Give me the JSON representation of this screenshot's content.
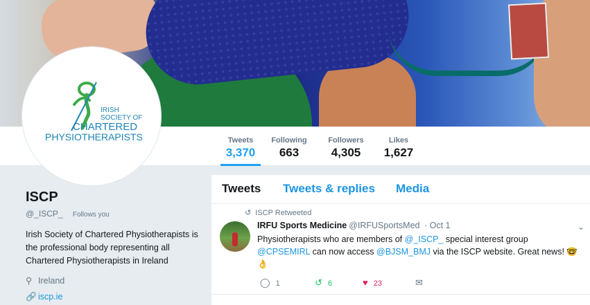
{
  "profile": {
    "name": "ISCP",
    "handle": "@_ISCP_",
    "follows_you": "Follows you",
    "bio": "Irish Society of Chartered Physiotherapists is the professional body representing all Chartered Physiotherapists in Ireland",
    "location": "Ireland",
    "website": "iscp.ie",
    "logo_lines": [
      "IRISH",
      "SOCIETY OF",
      "CHARTERED",
      "PHYSIOTHERAPISTS"
    ]
  },
  "stats": [
    {
      "label": "Tweets",
      "value": "3,370"
    },
    {
      "label": "Following",
      "value": "663"
    },
    {
      "label": "Followers",
      "value": "4,305"
    },
    {
      "label": "Likes",
      "value": "1,627"
    }
  ],
  "tabs": [
    "Tweets",
    "Tweets & replies",
    "Media"
  ],
  "tweet": {
    "retweeted_by": "ISCP Retweeted",
    "author_name": "IRFU Sports Medicine",
    "author_handle": "@IRFUSportsMed",
    "time": "· Oct 1",
    "text_1": "Physiotherapists who are members of ",
    "mention_1": "@_ISCP_",
    "text_2": "  special interest group ",
    "mention_2": "@CPSEMIRL",
    "text_3": " can now access ",
    "mention_3": "@BJSM_BMJ",
    "text_4": " via the ISCP website. Great news! 🤓 👌",
    "replies": "1",
    "retweets": "6",
    "likes": "23"
  },
  "colors": {
    "accent": "#1da1f2",
    "link": "#1b95e0",
    "like": "#e0245e",
    "retweet": "#17bf63",
    "logo_green": "#3daa4a",
    "logo_blue": "#1d84b5"
  },
  "icons": [
    "retweet-icon",
    "chevron-down-icon",
    "reply-icon",
    "heart-icon",
    "message-icon",
    "location-icon",
    "link-icon"
  ]
}
